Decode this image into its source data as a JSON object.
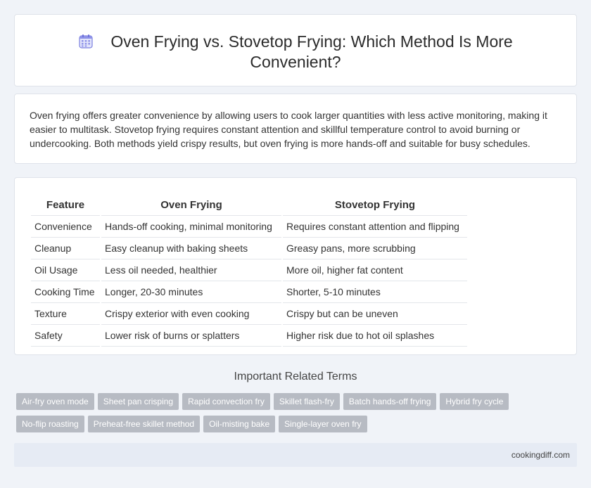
{
  "header": {
    "title": "Oven Frying vs. Stovetop Frying: Which Method Is More Convenient?",
    "icon": "calendar-icon"
  },
  "summary": "Oven frying offers greater convenience by allowing users to cook larger quantities with less active monitoring, making it easier to multitask. Stovetop frying requires constant attention and skillful temperature control to avoid burning or undercooking. Both methods yield crispy results, but oven frying is more hands-off and suitable for busy schedules.",
  "comparison": {
    "headers": [
      "Feature",
      "Oven Frying",
      "Stovetop Frying"
    ],
    "rows": [
      [
        "Convenience",
        "Hands-off cooking, minimal monitoring",
        "Requires constant attention and flipping"
      ],
      [
        "Cleanup",
        "Easy cleanup with baking sheets",
        "Greasy pans, more scrubbing"
      ],
      [
        "Oil Usage",
        "Less oil needed, healthier",
        "More oil, higher fat content"
      ],
      [
        "Cooking Time",
        "Longer, 20-30 minutes",
        "Shorter, 5-10 minutes"
      ],
      [
        "Texture",
        "Crispy exterior with even cooking",
        "Crispy but can be uneven"
      ],
      [
        "Safety",
        "Lower risk of burns or splatters",
        "Higher risk due to hot oil splashes"
      ]
    ]
  },
  "related": {
    "heading": "Important Related Terms",
    "tags_row1": [
      "Air-fry oven mode",
      "Sheet pan crisping",
      "Rapid convection fry",
      "Skillet flash-fry",
      "Batch hands-off frying",
      "Hybrid fry cycle"
    ],
    "tags_row2": [
      "No-flip roasting",
      "Preheat-free skillet method",
      "Oil-misting bake",
      "Single-layer oven fry"
    ]
  },
  "footer": {
    "site": "cookingdiff.com"
  },
  "colors": {
    "background": "#f0f3f8",
    "tag": "#b7bbc3",
    "footer": "#e6ebf4",
    "icon": "#7b7fe0"
  }
}
